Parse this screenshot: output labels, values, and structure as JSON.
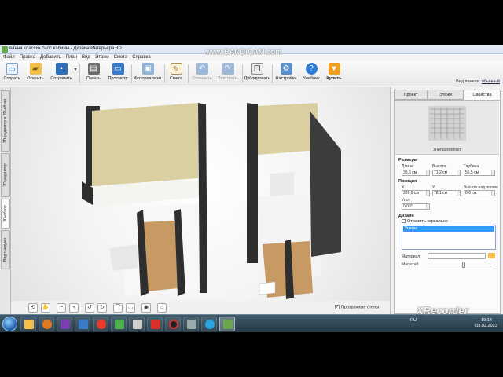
{
  "watermark": "www.BANDICAM.com",
  "recorder_watermark": "XRecorder",
  "window": {
    "title": "ванна классик снос кабины - Дизайн Интерьера 3D"
  },
  "menu": [
    "Файл",
    "Правка",
    "Добавить",
    "План",
    "Вид",
    "Этажи",
    "Смета",
    "Справка"
  ],
  "view_panel": {
    "label": "Вид панели:",
    "value": "обычный"
  },
  "toolbar": {
    "create": "Создать",
    "open": "Открыть",
    "save": "Сохранить",
    "print": "Печать",
    "preview": "Просмотр",
    "photo": "Фотореализм",
    "estimate": "Смета",
    "undo": "Отменить",
    "redo": "Повторить",
    "duplicate": "Дублировать",
    "settings": "Настройки",
    "tutorial": "Учебник",
    "buy": "Купить"
  },
  "left_tabs": [
    "2D-редактор и 3D-обзор",
    "2D-редактор",
    "3D-обзор",
    "Вид снаружи"
  ],
  "left_tabs_active": 2,
  "nav": {
    "transparent_walls": "Прозрачные стены",
    "transparent_walls_checked": true
  },
  "panel": {
    "tabs": [
      "Проект",
      "Этажи",
      "Свойства"
    ],
    "active_tab": 2,
    "item_name": "Унитаз компакт",
    "sizes_title": "Размеры",
    "length_label": "Длина:",
    "length": "35,6 см",
    "height_label": "Высота:",
    "height": "71,2 см",
    "depth_label": "Глубина:",
    "depth": "56,5 см",
    "position_title": "Позиция",
    "x_label": "X:",
    "x": "326,9 см",
    "y_label": "Y:",
    "y": "78,1 см",
    "floor_height_label": "Высота над полом:",
    "floor_height": "0,0 см",
    "angle_label": "Угол:",
    "angle": "0,00°",
    "design_title": "Дизайн",
    "mirror_label": "Отразить зеркально",
    "parts": [
      "Унитаз"
    ],
    "material_label": "Материал:",
    "scale_label": "Масштаб:"
  },
  "tray": {
    "lang": "RU",
    "time": "19:14",
    "date": "03.02.2023"
  },
  "colors": {
    "accent": "#2f6fb8",
    "selected": "#3399ff",
    "taskbar": "#2b414f",
    "wall_dark": "#2e2e2e",
    "floor_wood": "#c79a63",
    "wallpaper": "#d9cfa0"
  }
}
